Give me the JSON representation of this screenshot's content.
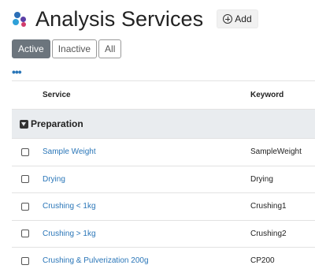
{
  "header": {
    "title": "Analysis Services",
    "add_label": "Add",
    "logo_icon": "senaite-logo-icon",
    "add_icon": "plus-circle-icon"
  },
  "filters": [
    {
      "label": "Active",
      "active": true
    },
    {
      "label": "Inactive",
      "active": false
    },
    {
      "label": "All",
      "active": false
    }
  ],
  "more_label": "•••",
  "table": {
    "columns": {
      "service": "Service",
      "keyword": "Keyword"
    },
    "group": {
      "label": "Preparation"
    },
    "rows": [
      {
        "service": "Sample Weight",
        "keyword": "SampleWeight"
      },
      {
        "service": "Drying",
        "keyword": "Drying"
      },
      {
        "service": "Crushing < 1kg",
        "keyword": "Crushing1"
      },
      {
        "service": "Crushing > 1kg",
        "keyword": "Crushing2"
      },
      {
        "service": "Crushing & Pulverization 200g",
        "keyword": "CP200"
      }
    ]
  },
  "colors": {
    "link": "#2a76b8",
    "active_filter": "#6c757d",
    "group_background": "#e9ecef"
  }
}
